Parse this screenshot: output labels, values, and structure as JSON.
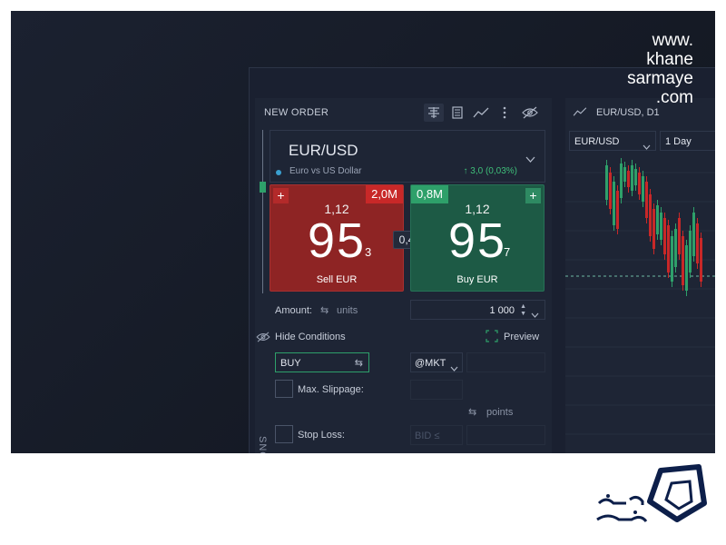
{
  "watermark": {
    "line1": "www.",
    "line2": "khane",
    "line3": "sarmaye",
    "line4": ".com"
  },
  "order_panel": {
    "title": "NEW ORDER",
    "toolbar_icons": [
      "ladder-icon",
      "calculator-icon",
      "chart-line-icon",
      "more-vertical-icon",
      "eye-off-icon"
    ]
  },
  "instrument": {
    "symbol": "EUR/USD",
    "description": "Euro vs US Dollar",
    "change": "↑ 3,0 (0,03%)"
  },
  "sell": {
    "plus": "+",
    "volume": "2,0M",
    "price_prefix": "1,12",
    "price_big": "95",
    "price_pip": "3",
    "label": "Sell EUR"
  },
  "buy": {
    "plus": "+",
    "volume": "0,8M",
    "price_prefix": "1,12",
    "price_big": "95",
    "price_pip": "7",
    "label": "Buy EUR"
  },
  "spread": "0,4",
  "amount": {
    "label": "Amount:",
    "swap": "⇆",
    "unit": "units",
    "value": "1 000"
  },
  "conditions": {
    "hide_label": "Hide Conditions",
    "preview_label": "Preview"
  },
  "side_select": {
    "value": "BUY",
    "swap": "⇆"
  },
  "order_type": {
    "value": "@MKT"
  },
  "slippage": {
    "label": "Max. Slippage:",
    "swap": "⇆",
    "unit": "points"
  },
  "stop_loss": {
    "label": "Stop Loss:",
    "placeholder": "BID ≤"
  },
  "vertical_tab": "SNO",
  "chart_panel": {
    "title": "EUR/USD, D1",
    "symbol_select": "EUR/USD",
    "period_select": "1 Day"
  },
  "colors": {
    "sell": "#8e2424",
    "buy": "#1d5a45",
    "candle_up": "#2ea06a",
    "candle_down": "#c82828",
    "background": "#1a2030"
  }
}
